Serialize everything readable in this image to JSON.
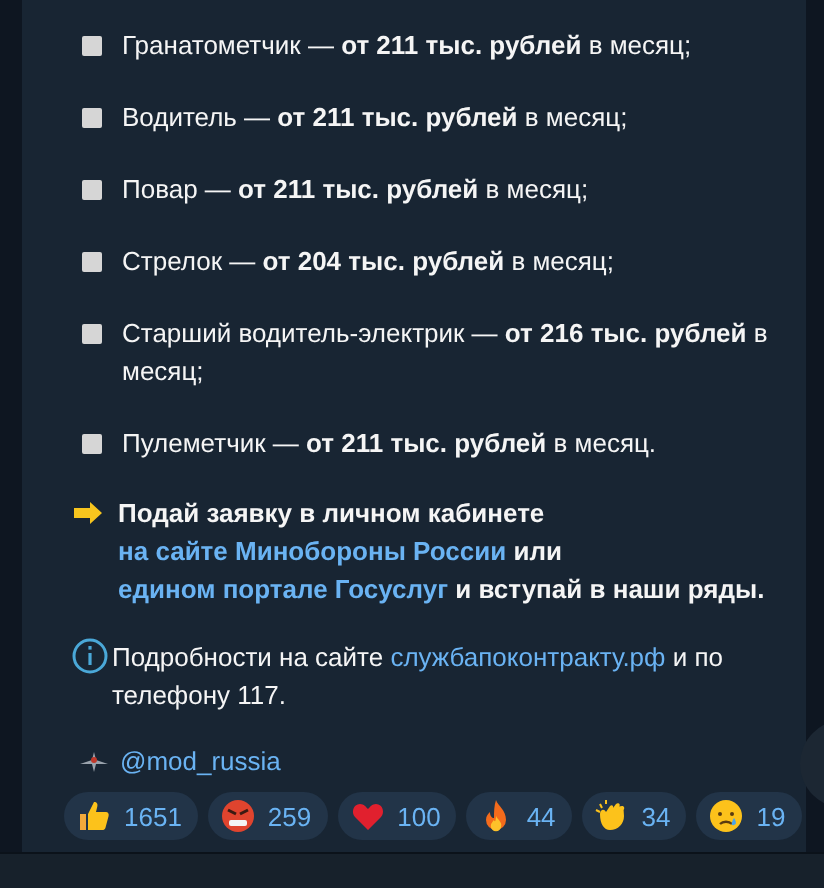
{
  "items": [
    {
      "text": "Гранатометчик — **от 211 тыс. рублей** в месяц;"
    },
    {
      "text": "Водитель — **от 211 тыс. рублей** в месяц;"
    },
    {
      "text": "Повар — **от 211 тыс. рублей** в месяц;"
    },
    {
      "text": "Стрелок — **от 204 тыс. рублей** в месяц;"
    },
    {
      "text": "Старший водитель-электрик — **от 216 тыс. рублей** в месяц;"
    },
    {
      "text": "Пулеметчик — **от 211 тыс. рублей** в месяц."
    }
  ],
  "call_to_action": [
    {
      "kind": "text",
      "text": "Подай заявку в личном кабинете "
    },
    {
      "kind": "link",
      "text": "на сайте Минобороны России"
    },
    {
      "kind": "text",
      "text": " или "
    },
    {
      "kind": "link",
      "text": "едином портале Госуслуг"
    },
    {
      "kind": "text",
      "text": " и вступай в наши ряды."
    }
  ],
  "info": [
    {
      "kind": "text",
      "text": "Подробности на сайте "
    },
    {
      "kind": "link",
      "text": "службапоконтракту.рф"
    },
    {
      "kind": "text",
      "text": " и по телефону 117."
    }
  ],
  "signature": "@mod_russia",
  "reactions": [
    {
      "kind": "thumbs",
      "count": "1651"
    },
    {
      "kind": "angry",
      "count": "259"
    },
    {
      "kind": "heart",
      "count": "100"
    },
    {
      "kind": "fire",
      "count": "44"
    },
    {
      "kind": "clap",
      "count": "34"
    },
    {
      "kind": "cry",
      "count": "19"
    }
  ]
}
